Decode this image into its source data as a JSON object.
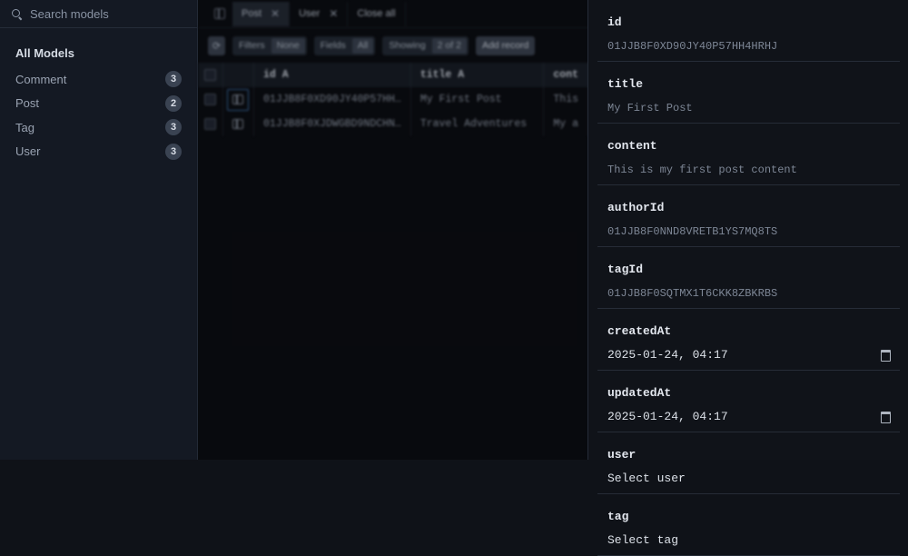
{
  "sidebar": {
    "search_placeholder": "Search models",
    "title": "All Models",
    "models": [
      {
        "name": "Comment",
        "count": "3"
      },
      {
        "name": "Post",
        "count": "2"
      },
      {
        "name": "Tag",
        "count": "3"
      },
      {
        "name": "User",
        "count": "3"
      }
    ]
  },
  "tabs": [
    {
      "label": "Post",
      "active": true
    },
    {
      "label": "User",
      "active": false
    }
  ],
  "tabs_close_all": "Close all",
  "toolbar": {
    "filters_label": "Filters",
    "filters_value": "None",
    "fields_label": "Fields",
    "fields_value": "All",
    "showing_label": "Showing",
    "showing_value": "2 of 2",
    "add_label": "Add record"
  },
  "table": {
    "columns": [
      "id A",
      "title A",
      "cont"
    ],
    "rows": [
      [
        "01JJB8F0XD90JY40P57HH…",
        "My First Post",
        "This"
      ],
      [
        "01JJB8F0XJDWGBD9NDCHN…",
        "Travel Adventures",
        "My a"
      ]
    ]
  },
  "record": {
    "fields": [
      {
        "label": "id",
        "value": "01JJB8F0XD90JY40P57HH4HRHJ"
      },
      {
        "label": "title",
        "value": "My First Post"
      },
      {
        "label": "content",
        "value": "This is my first post content"
      },
      {
        "label": "authorId",
        "value": "01JJB8F0NND8VRETB1YS7MQ8TS"
      },
      {
        "label": "tagId",
        "value": "01JJB8F0SQTMX1T6CKK8ZBKRBS"
      }
    ],
    "createdAt": {
      "label": "createdAt",
      "value": "2025-01-24, 04:17"
    },
    "updatedAt": {
      "label": "updatedAt",
      "value": "2025-01-24, 04:17"
    },
    "user": {
      "label": "user",
      "value": "Select user"
    },
    "tag": {
      "label": "tag",
      "value": "Select tag"
    }
  }
}
